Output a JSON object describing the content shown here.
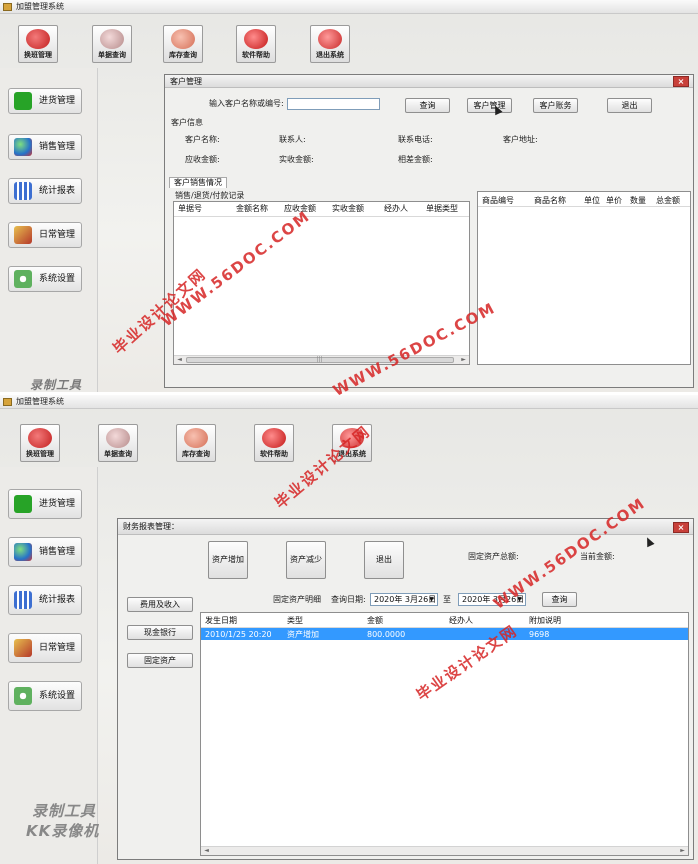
{
  "app": {
    "title": "加盟管理系统"
  },
  "toolbar": [
    "换班管理",
    "单据查询",
    "库存查询",
    "软件帮助",
    "退出系统"
  ],
  "sidebar": [
    "进货管理",
    "销售管理",
    "统计报表",
    "日常管理",
    "系统设置"
  ],
  "customer_window": {
    "title": "客户管理",
    "close_label": "×",
    "search_label": "输入客户名称或编号:",
    "search_value": "",
    "buttons": {
      "query": "查询",
      "manage": "客户管理",
      "account": "客户账务",
      "exit": "退出"
    },
    "info_header": "客户信息",
    "fields": {
      "name": "客户名称:",
      "contact": "联系人:",
      "phone": "联系电话:",
      "address": "客户地址:",
      "receivable": "应收金额:",
      "actual": "实收金额:",
      "diff": "相差金额:"
    },
    "tab_label": "客户销售情况",
    "group_label": "销售/退货/付款记录",
    "left_columns": [
      "单据号",
      "金额名称",
      "应收金额",
      "实收金额",
      "经办人",
      "单据类型"
    ],
    "right_columns": [
      "商品编号",
      "商品名称",
      "单位",
      "单价",
      "数量",
      "总金额"
    ],
    "scroll_left": "◄",
    "scroll_right": "►",
    "scroll_grip": "|||"
  },
  "finance_window": {
    "title": "财务报表管理：",
    "close_label": "×",
    "buttons": {
      "add": "资产增加",
      "reduce": "资产减少",
      "exit": "退出",
      "query": "查询"
    },
    "total_label": "固定资产总额:",
    "current_label": "当前金额:",
    "side_buttons": [
      "费用及收入",
      "现金银行",
      "固定资产"
    ],
    "detail_label": "固定资产明细",
    "date_label": "查询日期:",
    "date_from": "2020年 3月26日",
    "to_label": "至",
    "date_to": "2020年 3月26日",
    "dropdown_glyph": "▼",
    "columns": [
      "发生日期",
      "类型",
      "金额",
      "经办人",
      "附加说明"
    ],
    "rows": [
      {
        "date": "2010/1/25 20:20",
        "type": "资产增加",
        "amount": "800.0000",
        "handler": "",
        "note": "9698"
      }
    ]
  },
  "watermarks": {
    "site": "WWW.56DOC.COM",
    "text": "毕业设计论文网",
    "recorder": "录制工具",
    "recorder_app": "KK录像机"
  }
}
